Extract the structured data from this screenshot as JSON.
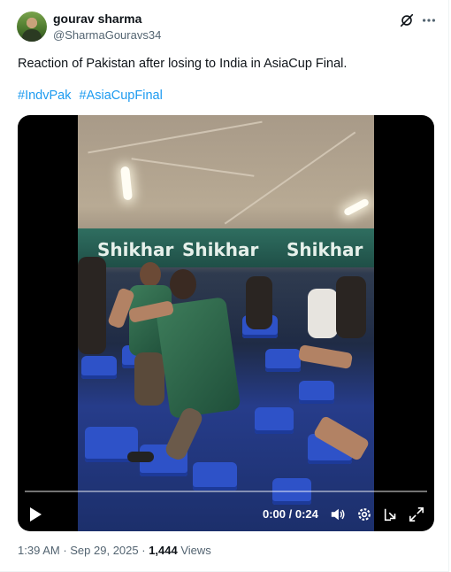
{
  "author": {
    "name": "gourav sharma",
    "handle": "@SharmaGouravs34"
  },
  "icons": {
    "avatar": "avatar",
    "grok": "grok-icon",
    "more": "more-icon",
    "play": "play-icon",
    "volume": "volume-icon",
    "settings": "gear-icon",
    "pip": "picture-in-picture-icon",
    "fullscreen": "fullscreen-icon"
  },
  "tweet": {
    "text": "Reaction of Pakistan after losing to India in AsiaCup Final.",
    "hashtags": [
      "#IndvPak",
      "#AsiaCupFinal"
    ]
  },
  "video": {
    "banner_text": "Shikhar",
    "current_time": "0:00",
    "separator": " / ",
    "duration": "0:24",
    "progress": 0
  },
  "meta": {
    "time": "1:39 AM",
    "dot": " · ",
    "date": "Sep 29, 2025",
    "views_count": "1,444",
    "views_label": "Views"
  },
  "colors": {
    "link": "#1d9bf0",
    "secondary_text": "#536471",
    "primary_text": "#0f1419"
  }
}
